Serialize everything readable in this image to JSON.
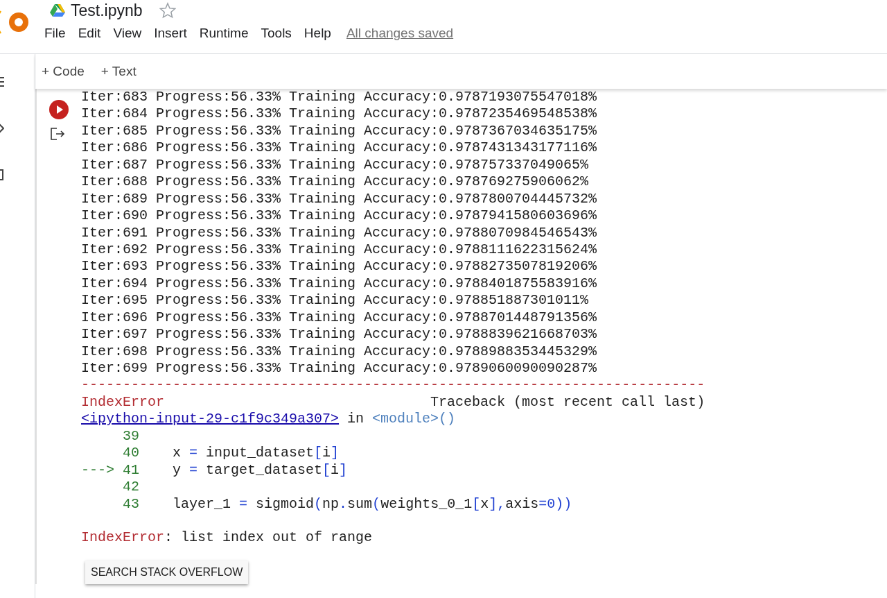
{
  "document": {
    "title": "Test.ipynb",
    "starred": false,
    "save_status": "All changes saved"
  },
  "menu": [
    "File",
    "Edit",
    "View",
    "Insert",
    "Runtime",
    "Tools",
    "Help"
  ],
  "toolbar": [
    {
      "label": "+ Code"
    },
    {
      "label": "+ Text"
    }
  ],
  "output_lines": [
    "Iter:683 Progress:56.33% Training Accuracy:0.9787193075547018%",
    "Iter:684 Progress:56.33% Training Accuracy:0.9787235469548538%",
    "Iter:685 Progress:56.33% Training Accuracy:0.9787367034635175%",
    "Iter:686 Progress:56.33% Training Accuracy:0.9787431343177116%",
    "Iter:687 Progress:56.33% Training Accuracy:0.978757337049065%",
    "Iter:688 Progress:56.33% Training Accuracy:0.978769275906062%",
    "Iter:689 Progress:56.33% Training Accuracy:0.9787800704445732%",
    "Iter:690 Progress:56.33% Training Accuracy:0.9787941580603696%",
    "Iter:691 Progress:56.33% Training Accuracy:0.9788070984546543%",
    "Iter:692 Progress:56.33% Training Accuracy:0.9788111622315624%",
    "Iter:693 Progress:56.33% Training Accuracy:0.9788273507819206%",
    "Iter:694 Progress:56.33% Training Accuracy:0.9788401875583916%",
    "Iter:695 Progress:56.33% Training Accuracy:0.978851887301011%",
    "Iter:696 Progress:56.33% Training Accuracy:0.9788701448791356%",
    "Iter:697 Progress:56.33% Training Accuracy:0.9788839621668703%",
    "Iter:698 Progress:56.33% Training Accuracy:0.9788988353445329%",
    "Iter:699 Progress:56.33% Training Accuracy:0.9789060090090287%"
  ],
  "traceback": {
    "separator": "---------------------------------------------------------------------------",
    "error_name": "IndexError",
    "header": "Traceback (most recent call last)",
    "source_link": "<ipython-input-29-c1f9c349a307>",
    "in_text": "in",
    "module": "<module>()",
    "code_lines": [
      {
        "number": "39"
      },
      {
        "number": "40",
        "tokens": [
          {
            "kind": "plain",
            "text": "x "
          },
          {
            "kind": "op",
            "text": "="
          },
          {
            "kind": "plain",
            "text": " input_dataset"
          },
          {
            "kind": "op",
            "text": "["
          },
          {
            "kind": "plain",
            "text": "i"
          },
          {
            "kind": "op",
            "text": "]"
          }
        ]
      },
      {
        "arrow": "--->",
        "number": "41",
        "tokens": [
          {
            "kind": "plain",
            "text": "y "
          },
          {
            "kind": "op",
            "text": "="
          },
          {
            "kind": "plain",
            "text": " target_dataset"
          },
          {
            "kind": "op",
            "text": "["
          },
          {
            "kind": "plain",
            "text": "i"
          },
          {
            "kind": "op",
            "text": "]"
          }
        ]
      },
      {
        "number": "42"
      },
      {
        "number": "43",
        "tokens": [
          {
            "kind": "plain",
            "text": "layer_1 "
          },
          {
            "kind": "op",
            "text": "="
          },
          {
            "kind": "plain",
            "text": " sigmoid"
          },
          {
            "kind": "op",
            "text": "("
          },
          {
            "kind": "plain",
            "text": "np"
          },
          {
            "kind": "op",
            "text": "."
          },
          {
            "kind": "plain",
            "text": "sum"
          },
          {
            "kind": "op",
            "text": "("
          },
          {
            "kind": "plain",
            "text": "weights_0_1"
          },
          {
            "kind": "op",
            "text": "["
          },
          {
            "kind": "plain",
            "text": "x"
          },
          {
            "kind": "op",
            "text": "],"
          },
          {
            "kind": "plain",
            "text": "axis"
          },
          {
            "kind": "op",
            "text": "="
          },
          {
            "kind": "num",
            "text": "0"
          },
          {
            "kind": "op",
            "text": "))"
          }
        ]
      }
    ],
    "error_type": "IndexError",
    "error_message": ": list index out of range"
  },
  "search_button": "SEARCH STACK OVERFLOW"
}
